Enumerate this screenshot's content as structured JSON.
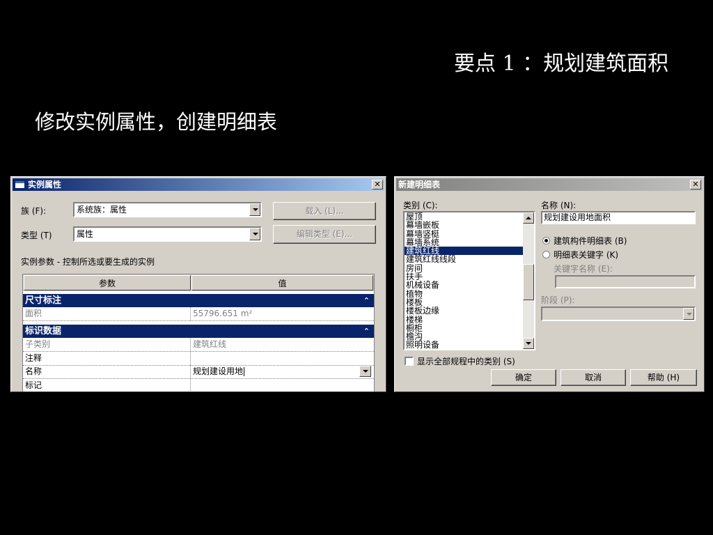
{
  "slide": {
    "title": "要点 1 ：规划建筑面积",
    "subtitle": "修改实例属性，创建明细表"
  },
  "instance_properties_dialog": {
    "title": "实例属性",
    "family_label": "族 (F):",
    "family_value": "系统族：属性",
    "type_label": "类型 (T)",
    "type_value": "属性",
    "load_button": "载入 (L)...",
    "edit_type_button": "编辑类型 (E)...",
    "instance_params_caption": "实例参数 - 控制所选或要生成的实例",
    "grid": {
      "headers": [
        "参数",
        "值"
      ],
      "groups": [
        {
          "name": "尺寸标注",
          "chevron": "⌃",
          "rows": [
            {
              "param": "面积",
              "value": "55796.651 m²",
              "readonly": true
            }
          ]
        },
        {
          "name": "标识数据",
          "chevron": "⌃",
          "rows": [
            {
              "param": "子类别",
              "value": "建筑红线",
              "readonly": true
            },
            {
              "param": "注释",
              "value": "",
              "readonly": false
            },
            {
              "param": "名称",
              "value": "规划建设用地",
              "readonly": false,
              "has_dropdown": true,
              "editing": true
            },
            {
              "param": "标记",
              "value": "",
              "readonly": false
            }
          ]
        }
      ]
    }
  },
  "new_schedule_dialog": {
    "title": "新建明细表",
    "category_label": "类别 (C):",
    "categories": [
      "屋顶",
      "幕墙嵌板",
      "幕墙竖梃",
      "幕墙系统",
      "建筑红线",
      "建筑红线线段",
      "房间",
      "扶手",
      "机械设备",
      "植物",
      "楼板",
      "楼板边缘",
      "楼梯",
      "橱柜",
      "檐沟",
      "照明设备"
    ],
    "selected_category": "建筑红线",
    "name_label": "名称 (N):",
    "name_value": "规划建设用地面积",
    "radio_component_schedule": "建筑构件明细表 (B)",
    "radio_key_schedule": "明细表关键字 (K)",
    "selected_radio": "component",
    "key_name_label": "关键字名称 (E):",
    "phase_label": "阶段 (P):",
    "show_all_checkbox_label": "显示全部规程中的类别 (S)",
    "ok_button": "确定",
    "cancel_button": "取消",
    "help_button": "帮助 (H)"
  },
  "icons": {
    "close": "close-icon",
    "dropdown_arrow": "chevron-down-icon",
    "collapse": "chevron-up-icon",
    "dialog": "window-icon"
  },
  "colors": {
    "background": "#000000",
    "dialog_face": "#d4d0c8",
    "active_title": "#0a246a",
    "selection": "#0a246a"
  }
}
